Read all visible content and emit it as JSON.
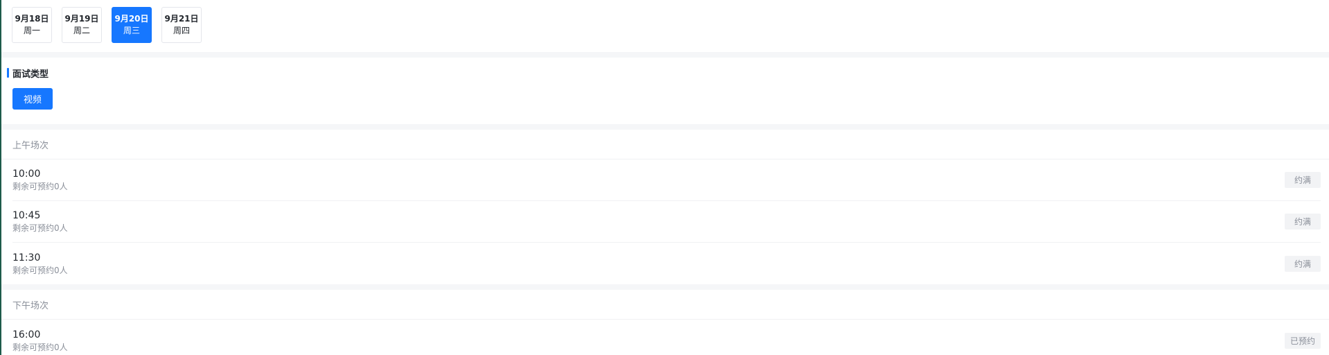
{
  "dates": [
    {
      "date": "9月18日",
      "weekday": "周一",
      "active": false
    },
    {
      "date": "9月19日",
      "weekday": "周二",
      "active": false
    },
    {
      "date": "9月20日",
      "weekday": "周三",
      "active": true
    },
    {
      "date": "9月21日",
      "weekday": "周四",
      "active": false
    }
  ],
  "interview_type": {
    "heading": "面试类型",
    "options": [
      "视频"
    ],
    "selected": "视频"
  },
  "morning": {
    "title": "上午场次",
    "slots": [
      {
        "time": "10:00",
        "remaining": "剩余可预约0人",
        "status": "约满"
      },
      {
        "time": "10:45",
        "remaining": "剩余可预约0人",
        "status": "约满"
      },
      {
        "time": "11:30",
        "remaining": "剩余可预约0人",
        "status": "约满"
      }
    ]
  },
  "afternoon": {
    "title": "下午场次",
    "slots": [
      {
        "time": "16:00",
        "remaining": "剩余可预约0人",
        "status": "已预约"
      }
    ]
  },
  "colors": {
    "accent": "#1677ff",
    "muted_text": "#8a8f99",
    "status_bg": "#f2f3f5",
    "section_gap": "#f5f6f8"
  }
}
